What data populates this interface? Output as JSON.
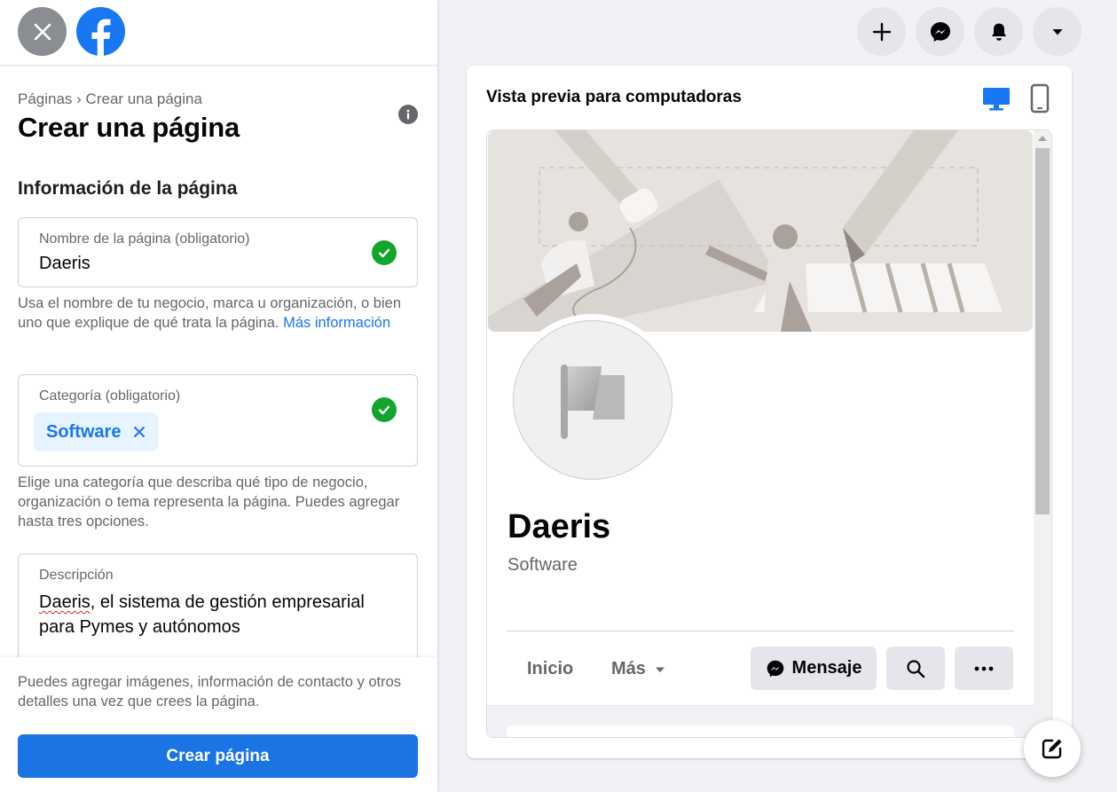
{
  "left_panel": {
    "close_icon": "close-icon",
    "logo": "facebook-logo",
    "breadcrumb": {
      "parent": "Páginas",
      "separator": " › ",
      "current": "Crear una página"
    },
    "title": "Crear una página",
    "info_icon": "info-icon",
    "section_title": "Información de la página",
    "name_field": {
      "label": "Nombre de la página (obligatorio)",
      "value": "Daeris",
      "status_icon": "check-circle-icon"
    },
    "name_help": {
      "text": "Usa el nombre de tu negocio, marca u organización, o bien uno que explique de qué trata la página. ",
      "link": "Más información"
    },
    "category_field": {
      "label": "Categoría (obligatorio)",
      "chips": [
        "Software"
      ],
      "status_icon": "check-circle-icon"
    },
    "category_help": "Elige una categoría que describa qué tipo de negocio, organización o tema representa la página. Puedes agregar hasta tres opciones.",
    "description_field": {
      "label": "Descripción",
      "value_misspelled": "Daeris",
      "value_rest": ", el sistema de gestión empresarial para Pymes y autónomos"
    },
    "bottom_text": "Puedes agregar imágenes, información de contacto y otros detalles una vez que crees la página.",
    "create_button": "Crear página"
  },
  "top_actions": [
    "plus-icon",
    "messenger-icon",
    "bell-icon",
    "caret-down-icon"
  ],
  "preview": {
    "title": "Vista previa para computadoras",
    "view_toggle": [
      "desktop-icon",
      "mobile-icon"
    ],
    "page_name": "Daeris",
    "page_category": "Software",
    "nav": {
      "home": "Inicio",
      "more": "Más"
    },
    "message_button": "Mensaje",
    "search_icon": "search-icon",
    "more_icon": "ellipsis-icon"
  },
  "compose_icon": "compose-icon",
  "colors": {
    "brand": "#1877F2",
    "success": "#12A52B",
    "button": "#1B74E4"
  }
}
